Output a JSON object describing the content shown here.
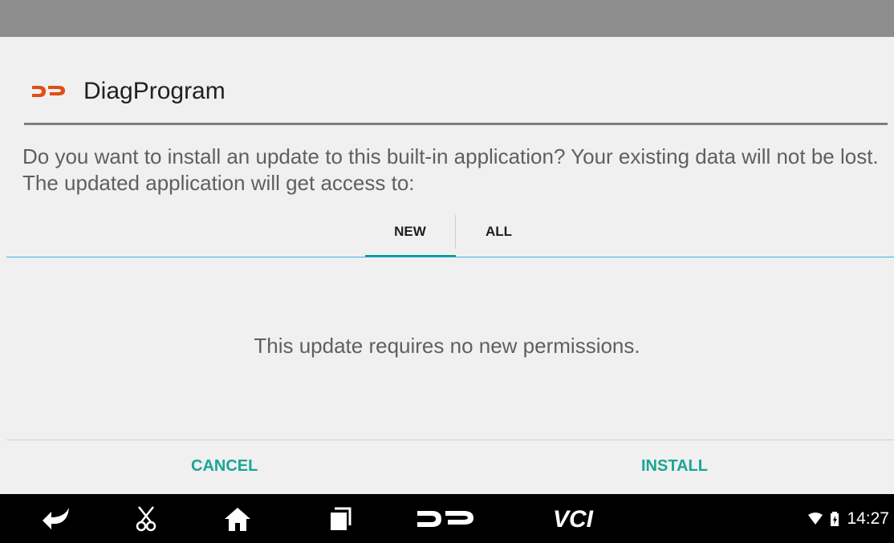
{
  "dialog": {
    "app_name": "DiagProgram",
    "description": "Do you want to install an update to this built-in application? Your existing data will not be lost. The updated application will get access to:",
    "tabs": [
      {
        "label": "NEW",
        "selected": true
      },
      {
        "label": "ALL",
        "selected": false
      }
    ],
    "message": "This update requires no new permissions.",
    "cancel_label": "CANCEL",
    "install_label": "INSTALL"
  },
  "nav_bar": {
    "icons": [
      "back-icon",
      "scissors-icon",
      "home-icon",
      "recents-icon",
      "dp-logo-icon",
      "vci-icon"
    ],
    "vci_label": "VCI",
    "clock": "14:27"
  },
  "colors": {
    "accent": "#1aa596",
    "tab_indicator": "#009688",
    "brand": "#e04e15"
  }
}
